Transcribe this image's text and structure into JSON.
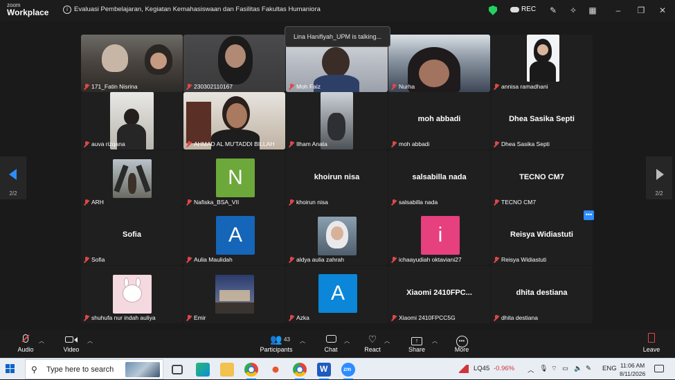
{
  "app": {
    "brand_small": "zoom",
    "brand_large": "Workplace"
  },
  "meeting": {
    "title": "Evaluasi Pembelajaran, Kegiatan Kemahasiswaan dan Fasilitas Fakultas Humaniora"
  },
  "titlebar": {
    "rec_label": "REC"
  },
  "talking": "Lina Hanifiyah_UPM is talking...",
  "pagination": {
    "left": "2/2",
    "right": "2/2"
  },
  "participants": [
    {
      "label": "171_Fatin Nisrina",
      "kind": "video"
    },
    {
      "label": "230302110167",
      "kind": "video"
    },
    {
      "label": "Moh Faiz",
      "kind": "video"
    },
    {
      "label": "Nurha",
      "kind": "video"
    },
    {
      "label": "annisa ramadhani",
      "kind": "photo"
    },
    {
      "label": "auva rizqana",
      "kind": "photo"
    },
    {
      "label": "AHMAD AL MU'TADDI BILLAH",
      "kind": "photo"
    },
    {
      "label": "Ilham Anata",
      "kind": "photo"
    },
    {
      "label": "moh abbadi",
      "display": "moh abbadi",
      "kind": "name"
    },
    {
      "label": "Dhea Sasika Septi",
      "display": "Dhea Sasika Septi",
      "kind": "name"
    },
    {
      "label": "ARH",
      "kind": "photo"
    },
    {
      "label": "Nafiska_BSA_VII",
      "letter": "N",
      "color": "#6da83a",
      "kind": "letter"
    },
    {
      "label": "khoirun nisa",
      "display": "khoirun nisa",
      "kind": "name"
    },
    {
      "label": "salsabilla nada",
      "display": "salsabilla nada",
      "kind": "name"
    },
    {
      "label": "TECNO CM7",
      "display": "TECNO CM7",
      "kind": "name"
    },
    {
      "label": "Sofia",
      "display": "Sofia",
      "kind": "name"
    },
    {
      "label": "Aulia Maulidah",
      "letter": "A",
      "color": "#1565b8",
      "kind": "letter"
    },
    {
      "label": "aldya aulia zahrah",
      "kind": "photo"
    },
    {
      "label": "ichaayudiah oktaviani27",
      "letter": "i",
      "color": "#e6407f",
      "kind": "letter"
    },
    {
      "label": "Reisya Widiastuti",
      "display": "Reisya Widiastuti",
      "kind": "name"
    },
    {
      "label": "shuhufa nur indah auliya",
      "kind": "photo"
    },
    {
      "label": "Emir",
      "kind": "photo"
    },
    {
      "label": "Azka",
      "letter": "A",
      "color": "#0b86d8",
      "kind": "letter"
    },
    {
      "label": "Xiaomi 2410FPCC5G",
      "display": "Xiaomi 2410FPC...",
      "kind": "name"
    },
    {
      "label": "dhita destiana",
      "display": "dhita destiana",
      "kind": "name"
    }
  ],
  "toolbar": {
    "audio": "Audio",
    "video": "Video",
    "participants": "Participants",
    "participants_count": "43",
    "chat": "Chat",
    "react": "React",
    "share": "Share",
    "more": "More",
    "leave": "Leave"
  },
  "taskbar": {
    "search_placeholder": "Type here to search",
    "stock_name": "LQ45",
    "stock_change": "-0.96%",
    "language": "ENG",
    "time": "11:06 AM",
    "date": "8/11/2026"
  },
  "colors": {
    "accent": "#2d8cff",
    "muted": "#e04848",
    "stock_down": "#d13438"
  }
}
